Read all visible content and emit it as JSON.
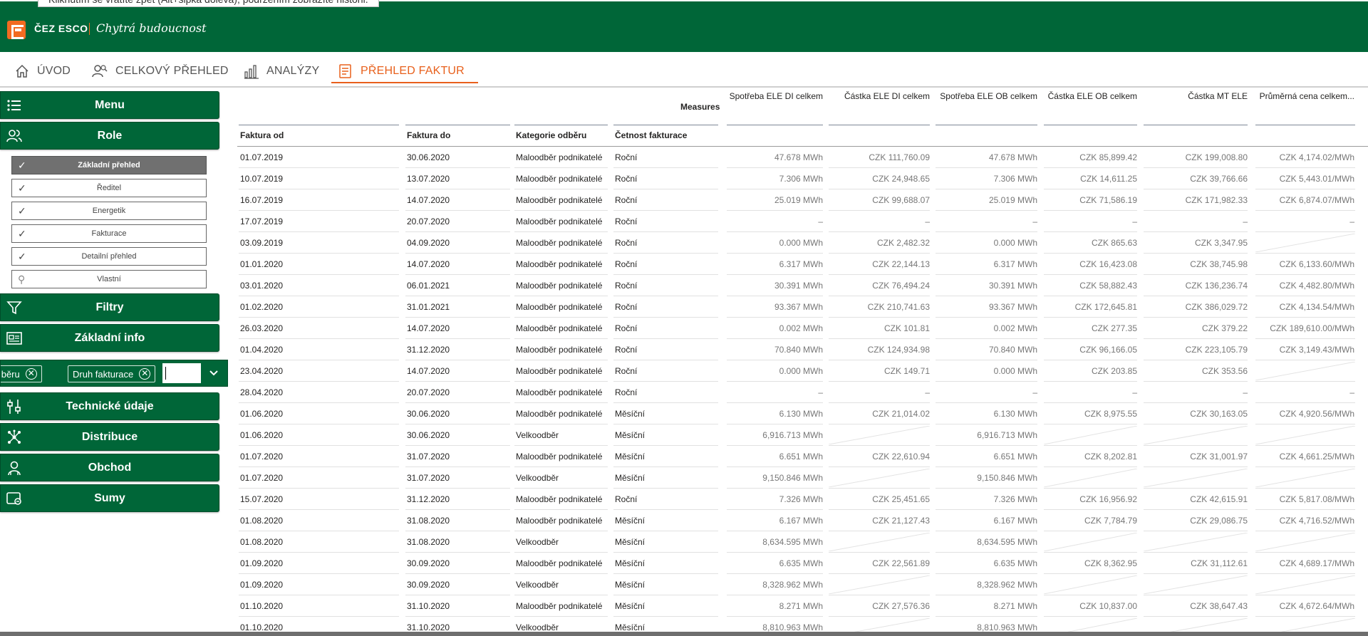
{
  "tooltip": "Kliknutím se vrátíte zpět (Alt+šipka doleva), podržením zobrazíte historii.",
  "brand": {
    "name": "ČEZ ESCO",
    "tagline": "Chytrá budoucnost",
    "color": "#006638",
    "accent": "#e8601c"
  },
  "nav": {
    "items": [
      {
        "label": "ÚVOD",
        "icon": "home-icon"
      },
      {
        "label": "CELKOVÝ PŘEHLED",
        "icon": "people-search-icon"
      },
      {
        "label": "ANALÝZY",
        "icon": "bar-chart-icon"
      },
      {
        "label": "PŘEHLED FAKTUR",
        "icon": "invoice-icon",
        "active": true
      }
    ]
  },
  "sidebar": {
    "menu": "Menu",
    "role": "Role",
    "roles": [
      "Základní přehled",
      "Ředitel",
      "Energetik",
      "Fakturace",
      "Detailní přehled",
      "Vlastní"
    ],
    "filtry": "Filtry",
    "zakladni_info": "Základní info",
    "pills": [
      "Kategorie odběru",
      "Druh fakturace"
    ],
    "technicke": "Technické údaje",
    "distribuce": "Distribuce",
    "obchod": "Obchod",
    "sumy": "Sumy"
  },
  "table": {
    "measures_label": "Measures",
    "row_headers": [
      "Faktura od",
      "Faktura do",
      "Kategorie odběru",
      "Četnost fakturace"
    ],
    "columns": [
      "Spotřeba ELE DI celkem",
      "Částka ELE DI celkem",
      "Spotřeba ELE OB celkem",
      "Částka ELE OB celkem",
      "Částka MT ELE",
      "Průměrná cena celkem..."
    ],
    "rows": [
      [
        "01.07.2019",
        "30.06.2020",
        "Maloodběr podnikatelé",
        "Roční",
        "47.678 MWh",
        "CZK 111,760.09",
        "47.678 MWh",
        "CZK 85,899.42",
        "CZK 199,008.80",
        "CZK 4,174.02/MWh"
      ],
      [
        "10.07.2019",
        "13.07.2020",
        "Maloodběr podnikatelé",
        "Roční",
        "7.306 MWh",
        "CZK 24,948.65",
        "7.306 MWh",
        "CZK 14,611.25",
        "CZK 39,766.66",
        "CZK 5,443.01/MWh"
      ],
      [
        "16.07.2019",
        "14.07.2020",
        "Maloodběr podnikatelé",
        "Roční",
        "25.019 MWh",
        "CZK 99,688.07",
        "25.019 MWh",
        "CZK 71,586.19",
        "CZK 171,982.33",
        "CZK 6,874.07/MWh"
      ],
      [
        "17.07.2019",
        "20.07.2020",
        "Maloodběr podnikatelé",
        "Roční",
        "–",
        "–",
        "–",
        "–",
        "–",
        "–"
      ],
      [
        "03.09.2019",
        "04.09.2020",
        "Maloodběr podnikatelé",
        "Roční",
        "0.000 MWh",
        "CZK 2,482.32",
        "0.000 MWh",
        "CZK 865.63",
        "CZK 3,347.95",
        ""
      ],
      [
        "01.01.2020",
        "14.07.2020",
        "Maloodběr podnikatelé",
        "Roční",
        "6.317 MWh",
        "CZK 22,144.13",
        "6.317 MWh",
        "CZK 16,423.08",
        "CZK 38,745.98",
        "CZK 6,133.60/MWh"
      ],
      [
        "03.01.2020",
        "06.01.2021",
        "Maloodběr podnikatelé",
        "Roční",
        "30.391 MWh",
        "CZK 76,494.24",
        "30.391 MWh",
        "CZK 58,882.43",
        "CZK 136,236.74",
        "CZK 4,482.80/MWh"
      ],
      [
        "01.02.2020",
        "31.01.2021",
        "Maloodběr podnikatelé",
        "Roční",
        "93.367 MWh",
        "CZK 210,741.63",
        "93.367 MWh",
        "CZK 172,645.81",
        "CZK 386,029.72",
        "CZK 4,134.54/MWh"
      ],
      [
        "26.03.2020",
        "14.07.2020",
        "Maloodběr podnikatelé",
        "Roční",
        "0.002 MWh",
        "CZK 101.81",
        "0.002 MWh",
        "CZK 277.35",
        "CZK 379.22",
        "CZK 189,610.00/MWh"
      ],
      [
        "01.04.2020",
        "31.12.2020",
        "Maloodběr podnikatelé",
        "Roční",
        "70.840 MWh",
        "CZK 124,934.98",
        "70.840 MWh",
        "CZK 96,166.05",
        "CZK 223,105.79",
        "CZK 3,149.43/MWh"
      ],
      [
        "23.04.2020",
        "14.07.2020",
        "Maloodběr podnikatelé",
        "Roční",
        "0.000 MWh",
        "CZK 149.71",
        "0.000 MWh",
        "CZK 203.85",
        "CZK 353.56",
        ""
      ],
      [
        "28.04.2020",
        "20.07.2020",
        "Maloodběr podnikatelé",
        "Roční",
        "–",
        "–",
        "–",
        "–",
        "–",
        "–"
      ],
      [
        "01.06.2020",
        "30.06.2020",
        "Maloodběr podnikatelé",
        "Měsíční",
        "6.130 MWh",
        "CZK 21,014.02",
        "6.130 MWh",
        "CZK 8,975.55",
        "CZK 30,163.05",
        "CZK 4,920.56/MWh"
      ],
      [
        "01.06.2020",
        "30.06.2020",
        "Velkoodběr",
        "Měsíční",
        "6,916.713 MWh",
        "",
        "6,916.713 MWh",
        "",
        "",
        ""
      ],
      [
        "01.07.2020",
        "31.07.2020",
        "Maloodběr podnikatelé",
        "Měsíční",
        "6.651 MWh",
        "CZK 22,610.94",
        "6.651 MWh",
        "CZK 8,202.81",
        "CZK 31,001.97",
        "CZK 4,661.25/MWh"
      ],
      [
        "01.07.2020",
        "31.07.2020",
        "Velkoodběr",
        "Měsíční",
        "9,150.846 MWh",
        "",
        "9,150.846 MWh",
        "",
        "",
        ""
      ],
      [
        "15.07.2020",
        "31.12.2020",
        "Maloodběr podnikatelé",
        "Roční",
        "7.326 MWh",
        "CZK 25,451.65",
        "7.326 MWh",
        "CZK 16,956.92",
        "CZK 42,615.91",
        "CZK 5,817.08/MWh"
      ],
      [
        "01.08.2020",
        "31.08.2020",
        "Maloodběr podnikatelé",
        "Měsíční",
        "6.167 MWh",
        "CZK 21,127.43",
        "6.167 MWh",
        "CZK 7,784.79",
        "CZK 29,086.75",
        "CZK 4,716.52/MWh"
      ],
      [
        "01.08.2020",
        "31.08.2020",
        "Velkoodběr",
        "Měsíční",
        "8,634.595 MWh",
        "",
        "8,634.595 MWh",
        "",
        "",
        ""
      ],
      [
        "01.09.2020",
        "30.09.2020",
        "Maloodběr podnikatelé",
        "Měsíční",
        "6.635 MWh",
        "CZK 22,561.89",
        "6.635 MWh",
        "CZK 8,362.95",
        "CZK 31,112.61",
        "CZK 4,689.17/MWh"
      ],
      [
        "01.09.2020",
        "30.09.2020",
        "Velkoodběr",
        "Měsíční",
        "8,328.962 MWh",
        "",
        "8,328.962 MWh",
        "",
        "",
        ""
      ],
      [
        "01.10.2020",
        "31.10.2020",
        "Maloodběr podnikatelé",
        "Měsíční",
        "8.271 MWh",
        "CZK 27,576.36",
        "8.271 MWh",
        "CZK 10,837.00",
        "CZK 38,647.43",
        "CZK 4,672.64/MWh"
      ],
      [
        "01.10.2020",
        "31.10.2020",
        "Velkoodběr",
        "Měsíční",
        "8,810.963 MWh",
        "",
        "8,810.963 MWh",
        "",
        "",
        ""
      ]
    ]
  }
}
